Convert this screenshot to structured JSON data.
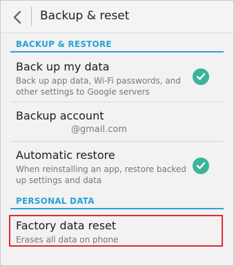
{
  "header": {
    "title": "Backup & reset",
    "back_icon": "chevron-left-icon"
  },
  "sections": {
    "backup_restore": "BACKUP & RESTORE",
    "personal_data": "PERSONAL DATA"
  },
  "items": {
    "backup_data": {
      "title": "Back up my data",
      "subtitle": "Back up app data, Wi-Fi passwords, and other settings to Google servers",
      "checked": true
    },
    "backup_account": {
      "title": "Backup account",
      "subtitle": "@gmail.com"
    },
    "auto_restore": {
      "title": "Automatic restore",
      "subtitle": "When reinstalling an app, restore backed up settings and data",
      "checked": true
    },
    "factory_reset": {
      "title": "Factory data reset",
      "subtitle": "Erases all data on phone"
    }
  },
  "colors": {
    "accent": "#2aa3d6",
    "check": "#3cb39b",
    "highlight": "#e0282f"
  }
}
